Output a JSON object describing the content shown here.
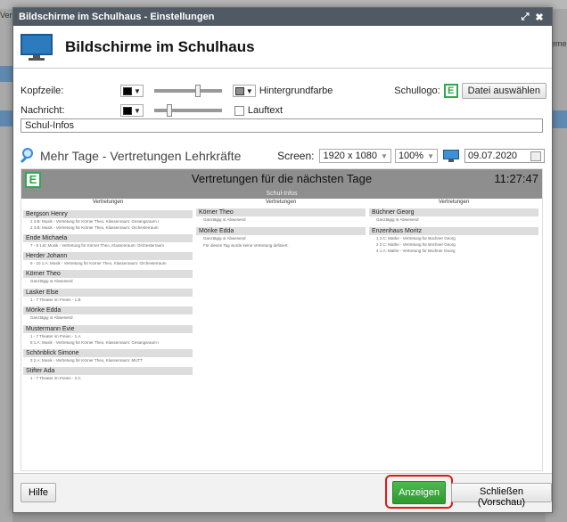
{
  "background": {
    "left_label": "Vert",
    "right_header": "Bemer"
  },
  "dialog": {
    "title": "Bildschirme im Schulhaus - Einstellungen",
    "heading": "Bildschirme im Schulhaus",
    "kopfzeile_label": "Kopfzeile:",
    "hintergrundfarbe_label": "Hintergrundfarbe",
    "schullogo_label": "Schullogo:",
    "datei_button": "Datei auswählen",
    "nachricht_label": "Nachricht:",
    "lauftext_label": "Lauftext",
    "message_value": "Schul-Infos",
    "preview_title": "Mehr Tage - Vertretungen Lehrkräfte",
    "screen_label": "Screen:",
    "resolution": "1920 x 1080",
    "zoom": "100%",
    "date": "09.07.2020",
    "colors": {
      "kopfzeile_color": "#000000",
      "hintergrund_color": "#8e8e8e",
      "nachricht_color": "#000000"
    }
  },
  "preview": {
    "title": "Vertretungen für die nächsten Tage",
    "time": "11:27:47",
    "subtitle": "Schul-Infos",
    "columns": [
      {
        "header": "Vertretungen",
        "cards": [
          {
            "name": "Bergson Henry",
            "lines": [
              "1    3.B: Musik - Vertretung für Körner Theo, Klassenraum: Gesangsraum I",
              "2    3.B: Musik - Vertretung für Körner Theo, Klassenraum: Orchesterraum"
            ]
          },
          {
            "name": "Ende Michaela",
            "lines": [
              "7 - 8   1.B: Musik - Vertretung für Körner Theo, Klassenraum: Orchesterraum"
            ]
          },
          {
            "name": "Herder Johann",
            "lines": [
              "9 - 10   1.A: Musik - Vertretung für Körner Theo, Klassenraum: Orchesterraum"
            ]
          },
          {
            "name": "Körner Theo",
            "lines": [
              "Ganztägig   ⊘ Abwesend"
            ]
          },
          {
            "name": "Lasker Else",
            "lines": [
              "1 - 7   Theater im Freien - 1.B"
            ]
          },
          {
            "name": "Mörike Edda",
            "lines": [
              "Ganztägig   ⊘ Abwesend"
            ]
          },
          {
            "name": "Mustermann Evie",
            "lines": [
              "1 - 7   Theater im Freien - 1.A",
              "8    1.A: Musik - Vertretung für Körner Theo, Klassenraum: Gesangsraum I"
            ]
          },
          {
            "name": "Schönblick Simone",
            "lines": [
              "3    2.A: Musik - Vertretung für Körner Theo, Klassenraum: MUTT"
            ]
          },
          {
            "name": "Stifter Ada",
            "lines": [
              "1 - 7   Theater im Freien - 2.C"
            ]
          }
        ]
      },
      {
        "header": "Vertretungen",
        "cards": [
          {
            "name": "Körner Theo",
            "lines": [
              "Ganztägig   ⊘ Abwesend"
            ]
          },
          {
            "name": "Mörike Edda",
            "lines": [
              "Ganztägig   ⊘ Abwesend",
              "Für diesen Tag wurde keine Vertretung definiert."
            ]
          }
        ]
      },
      {
        "header": "Vertretungen",
        "cards": [
          {
            "name": "Büchner Georg",
            "lines": [
              "Ganztägig   ⊘ Abwesend"
            ]
          },
          {
            "name": "Enzenhaus Moritz",
            "lines": [
              "1    2.C: Mathe - Vertretung für Büchner Georg",
              "2    2.C: Mathe - Vertretung für Büchner Georg",
              "4    1.A: Mathe - Vertretung für Büchner Georg"
            ]
          }
        ]
      }
    ]
  },
  "footer": {
    "help": "Hilfe",
    "show": "Anzeigen",
    "close": "Schließen (Vorschau)"
  }
}
